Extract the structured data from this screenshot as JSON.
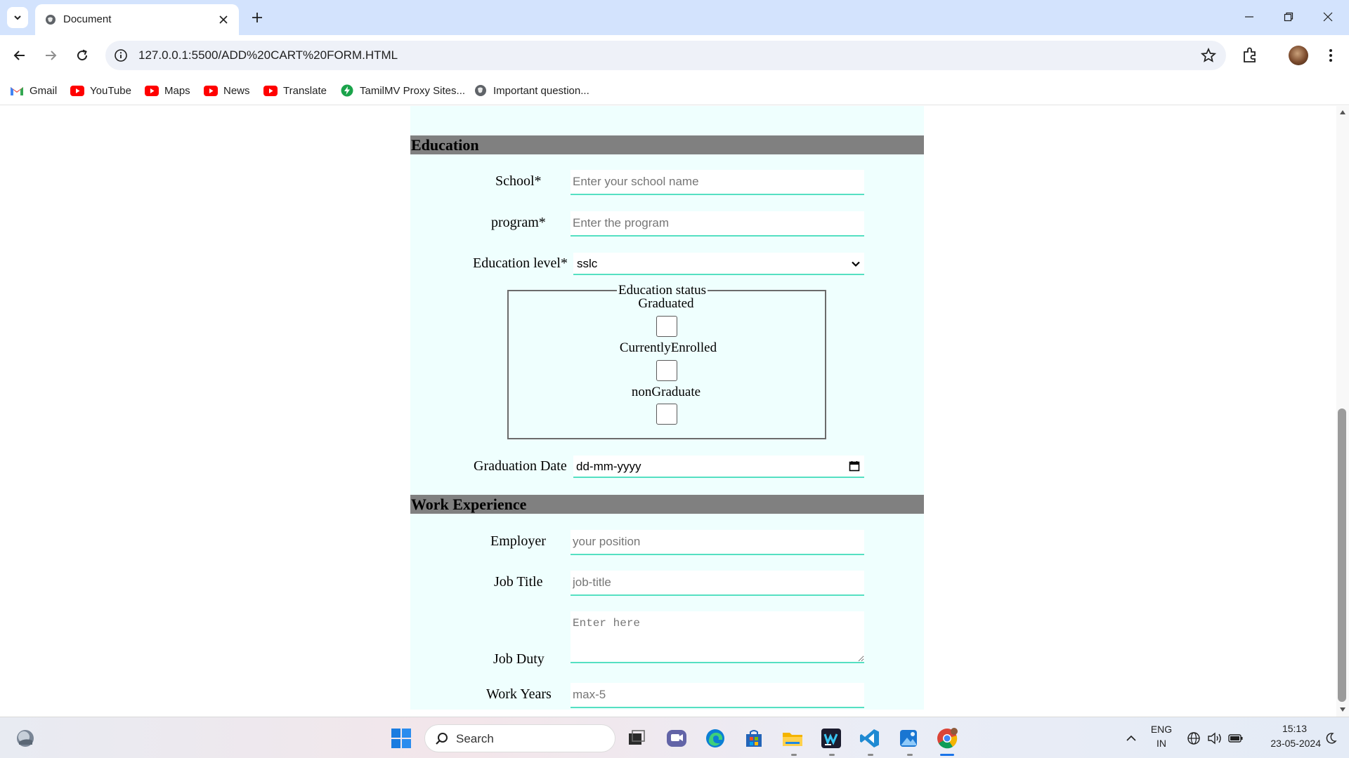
{
  "browser": {
    "tab_title": "Document",
    "url": "127.0.0.1:5500/ADD%20CART%20FORM.HTML",
    "bookmarks": [
      {
        "label": "Gmail",
        "icon": "gmail-icon"
      },
      {
        "label": "YouTube",
        "icon": "youtube-icon"
      },
      {
        "label": "Maps",
        "icon": "youtube-icon"
      },
      {
        "label": "News",
        "icon": "youtube-icon"
      },
      {
        "label": "Translate",
        "icon": "youtube-icon"
      },
      {
        "label": "TamilMV Proxy Sites...",
        "icon": "bolt-icon"
      },
      {
        "label": "Important question...",
        "icon": "globe-icon"
      }
    ]
  },
  "form": {
    "education": {
      "heading": "Education",
      "school_label": "School*",
      "school_placeholder": "Enter your school name",
      "program_label": "program*",
      "program_placeholder": "Enter the program",
      "level_label": "Education level*",
      "level_value": "sslc",
      "status_legend": "Education status",
      "status_options": [
        "Graduated",
        "CurrentlyEnrolled",
        "nonGraduate"
      ],
      "grad_date_label": "Graduation Date",
      "grad_date_value": "dd-mm-yyyy"
    },
    "work": {
      "heading": "Work Experience",
      "employer_label": "Employer",
      "employer_placeholder": "your position",
      "job_title_label": "Job Title",
      "job_title_placeholder": "job-title",
      "job_duty_label": "Job Duty",
      "job_duty_placeholder": "Enter here",
      "work_years_label": "Work Years",
      "work_years_placeholder": "max-5"
    }
  },
  "taskbar": {
    "search_text": "Search",
    "lang_top": "ENG",
    "lang_bottom": "IN",
    "time": "15:13",
    "date": "23-05-2024"
  },
  "colors": {
    "tabstrip": "#d3e3fd",
    "form_bg": "#effffe",
    "section_bar": "#808080",
    "input_underline": "#55e0c2"
  }
}
